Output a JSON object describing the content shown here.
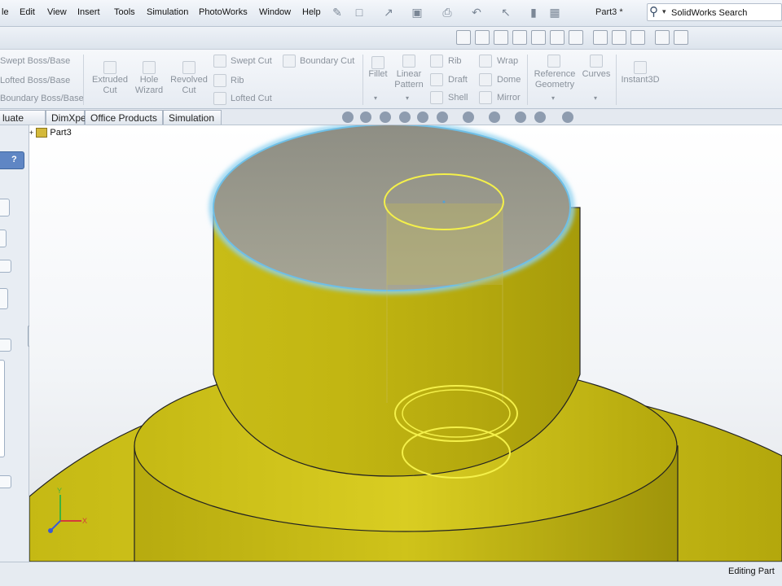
{
  "menu": [
    "le",
    "Edit",
    "View",
    "Insert",
    "Tools",
    "Simulation",
    "PhotoWorks",
    "Window",
    "Help"
  ],
  "document_title": "Part3 *",
  "search": {
    "label": "SolidWorks Search"
  },
  "ribbon": {
    "boss_group": [
      "Swept Boss/Base",
      "Lofted Boss/Base",
      "Boundary Boss/Base"
    ],
    "extruded_cut": [
      "Extruded",
      "Cut"
    ],
    "hole_wizard": [
      "Hole",
      "Wizard"
    ],
    "revolved_cut": [
      "Revolved",
      "Cut"
    ],
    "cut_group": [
      "Swept Cut",
      "Rib",
      "Lofted Cut"
    ],
    "boundary_cut": "Boundary Cut",
    "fillet": "Fillet",
    "linear_pattern": [
      "Linear",
      "Pattern"
    ],
    "feature_group_a": [
      "Rib",
      "Draft",
      "Shell"
    ],
    "feature_group_b": [
      "Wrap",
      "Dome",
      "Mirror"
    ],
    "reference_geometry": [
      "Reference",
      "Geometry"
    ],
    "curves": "Curves",
    "instant3d": "Instant3D"
  },
  "cm_tabs": [
    "luate",
    "DimXpert",
    "Office Products",
    "Simulation"
  ],
  "tree": {
    "part_name": "Part3"
  },
  "status": "Editing Part",
  "colors": {
    "model_yellow": "#d3c61a",
    "top_face_gray": "#9c9c8e",
    "highlight_blue": "#8fd2f0",
    "sketch_yellow": "#f4f04a"
  }
}
